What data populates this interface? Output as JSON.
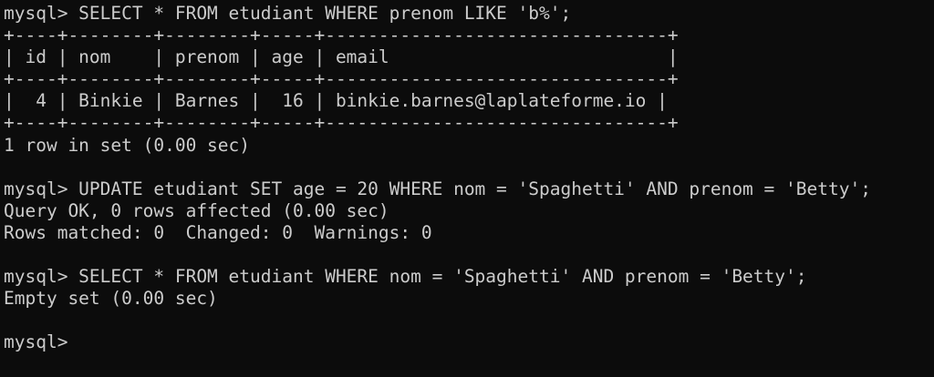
{
  "terminal": {
    "lines": [
      "mysql> SELECT * FROM etudiant WHERE prenom LIKE 'b%';",
      "+----+--------+--------+-----+--------------------------------+",
      "| id | nom    | prenom | age | email                          |",
      "+----+--------+--------+-----+--------------------------------+",
      "|  4 | Binkie | Barnes |  16 | binkie.barnes@laplateforme.io |",
      "+----+--------+--------+-----+--------------------------------+",
      "1 row in set (0.00 sec)",
      "",
      "mysql> UPDATE etudiant SET age = 20 WHERE nom = 'Spaghetti' AND prenom = 'Betty';",
      "Query OK, 0 rows affected (0.00 sec)",
      "Rows matched: 0  Changed: 0  Warnings: 0",
      "",
      "mysql> SELECT * FROM etudiant WHERE nom = 'Spaghetti' AND prenom = 'Betty';",
      "Empty set (0.00 sec)",
      "",
      "mysql> "
    ]
  },
  "colors": {
    "background": "#0c0c0c",
    "foreground": "#cccccc"
  }
}
